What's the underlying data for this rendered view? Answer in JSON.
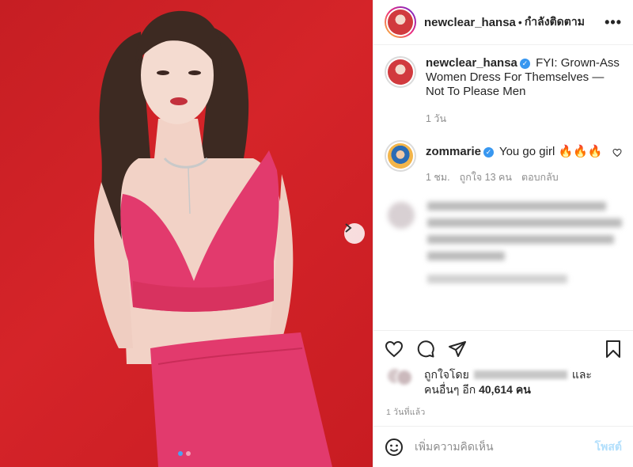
{
  "post": {
    "image_alt": "woman in pink outfit on red background",
    "carousel": {
      "count": 2,
      "active": 0
    }
  },
  "header": {
    "username": "newclear_hansa",
    "separator": "•",
    "follow_label": "กำลังติดตาม",
    "more_label": "•••"
  },
  "caption": {
    "username": "newclear_hansa",
    "text": "FYI: Grown-Ass Women Dress For Themselves — Not To Please Men",
    "time": "1 วัน"
  },
  "comment1": {
    "username": "zommarie",
    "text": "You go girl 🔥🔥🔥",
    "time": "1 ชม.",
    "likes": "ถูกใจ 13 คน",
    "reply": "ตอบกลับ"
  },
  "likes": {
    "prefix": "ถูกใจโดย",
    "and": "และ",
    "others_prefix": "คนอื่นๆ อีก",
    "count": "40,614",
    "suffix": "คน"
  },
  "time_ago": "1 วันที่แล้ว",
  "add_comment": {
    "placeholder": "เพิ่มความคิดเห็น",
    "post_label": "โพสต์"
  },
  "colors": {
    "accent": "#3897f0",
    "post_disabled": "#b2dffc",
    "photo_bg": "#d12328",
    "outfit": "#e23a6d"
  }
}
